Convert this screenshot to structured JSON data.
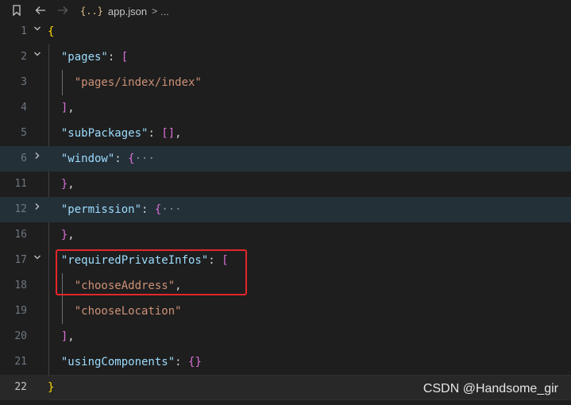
{
  "breadcrumb": {
    "file_icon_glyph": "{..}",
    "file_name": "app.json",
    "separator": ">",
    "ellipsis": "..."
  },
  "lines": [
    {
      "number": "1",
      "fold": "open",
      "tokens": [
        {
          "t": "{",
          "c": "b1"
        }
      ]
    },
    {
      "number": "2",
      "fold": "open",
      "tokens": [
        {
          "t": "  "
        },
        {
          "t": "\"pages\"",
          "c": "k"
        },
        {
          "t": ": ",
          "c": "p"
        },
        {
          "t": "[",
          "c": "b2"
        }
      ]
    },
    {
      "number": "3",
      "tokens": [
        {
          "t": "    "
        },
        {
          "t": "\"pages/index/index\"",
          "c": "s"
        }
      ]
    },
    {
      "number": "4",
      "tokens": [
        {
          "t": "  "
        },
        {
          "t": "]",
          "c": "b2"
        },
        {
          "t": ",",
          "c": "p"
        }
      ]
    },
    {
      "number": "5",
      "tokens": [
        {
          "t": "  "
        },
        {
          "t": "\"subPackages\"",
          "c": "k"
        },
        {
          "t": ": ",
          "c": "p"
        },
        {
          "t": "[]",
          "c": "b2"
        },
        {
          "t": ",",
          "c": "p"
        }
      ]
    },
    {
      "number": "6",
      "fold": "closed",
      "tokens": [
        {
          "t": "  "
        },
        {
          "t": "\"window\"",
          "c": "k"
        },
        {
          "t": ": ",
          "c": "p"
        },
        {
          "t": "{",
          "c": "b2"
        },
        {
          "t": "···",
          "c": "ell"
        }
      ]
    },
    {
      "number": "11",
      "tokens": [
        {
          "t": "  "
        },
        {
          "t": "}",
          "c": "b2"
        },
        {
          "t": ",",
          "c": "p"
        }
      ]
    },
    {
      "number": "12",
      "fold": "closed",
      "tokens": [
        {
          "t": "  "
        },
        {
          "t": "\"permission\"",
          "c": "k"
        },
        {
          "t": ": ",
          "c": "p"
        },
        {
          "t": "{",
          "c": "b2"
        },
        {
          "t": "···",
          "c": "ell"
        }
      ]
    },
    {
      "number": "16",
      "tokens": [
        {
          "t": "  "
        },
        {
          "t": "}",
          "c": "b2"
        },
        {
          "t": ",",
          "c": "p"
        }
      ]
    },
    {
      "number": "17",
      "fold": "open",
      "tokens": [
        {
          "t": "  "
        },
        {
          "t": "\"requiredPrivateInfos\"",
          "c": "k"
        },
        {
          "t": ": ",
          "c": "p"
        },
        {
          "t": "[",
          "c": "b2"
        }
      ]
    },
    {
      "number": "18",
      "tokens": [
        {
          "t": "    "
        },
        {
          "t": "\"chooseAddress\"",
          "c": "s"
        },
        {
          "t": ",",
          "c": "p"
        }
      ]
    },
    {
      "number": "19",
      "tokens": [
        {
          "t": "    "
        },
        {
          "t": "\"chooseLocation\"",
          "c": "s"
        }
      ]
    },
    {
      "number": "20",
      "tokens": [
        {
          "t": "  "
        },
        {
          "t": "]",
          "c": "b2"
        },
        {
          "t": ",",
          "c": "p"
        }
      ]
    },
    {
      "number": "21",
      "tokens": [
        {
          "t": "  "
        },
        {
          "t": "\"usingComponents\"",
          "c": "k"
        },
        {
          "t": ": ",
          "c": "p"
        },
        {
          "t": "{}",
          "c": "b2"
        }
      ]
    },
    {
      "number": "22",
      "current": true,
      "tokens": [
        {
          "t": "}",
          "c": "b1"
        }
      ]
    }
  ],
  "watermark": "CSDN @Handsome_gir",
  "colors": {
    "background": "#1e1e1e",
    "key": "#9cdcfe",
    "string": "#ce9178",
    "bracket_level1": "#ffd700",
    "bracket_level2": "#da70d6",
    "highlight_box": "#e5262b"
  }
}
